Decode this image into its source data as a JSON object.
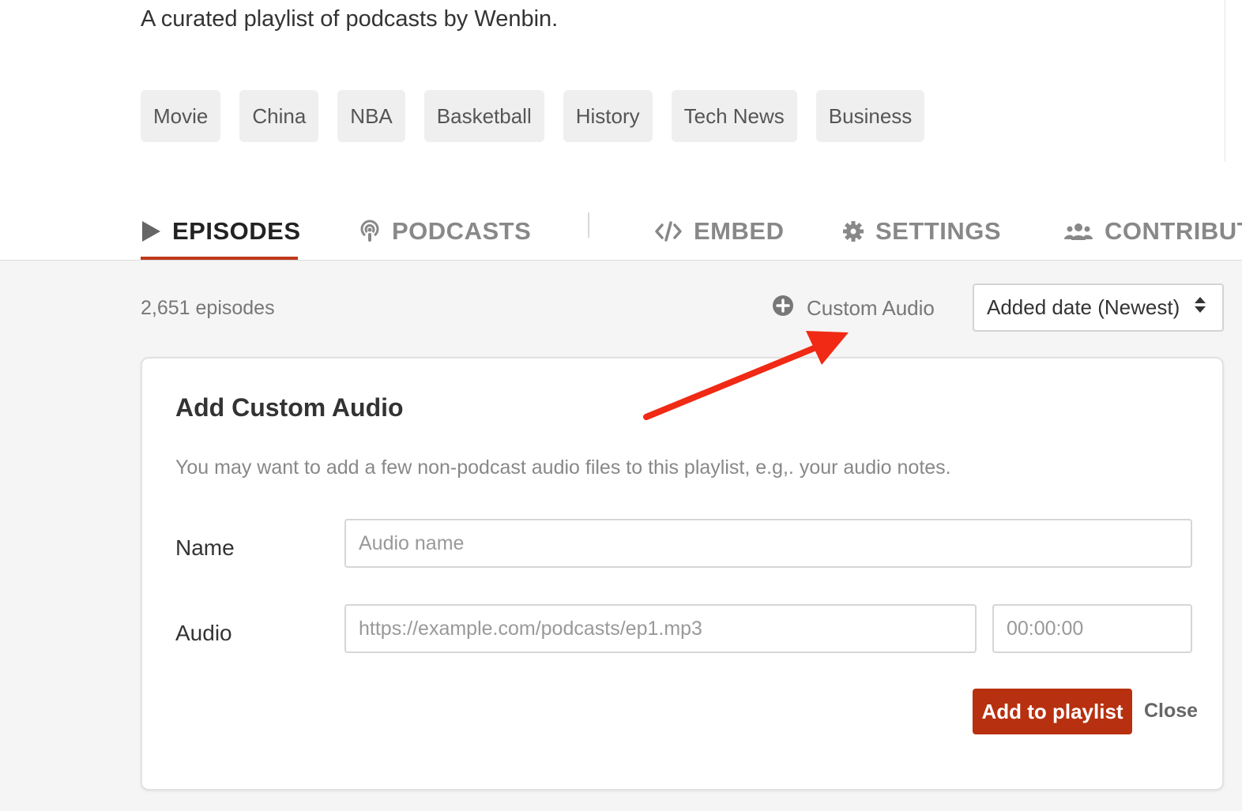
{
  "playlist": {
    "description": "A curated playlist of podcasts by Wenbin.",
    "tags": [
      "Movie",
      "China",
      "NBA",
      "Basketball",
      "History",
      "Tech News",
      "Business"
    ]
  },
  "tabs": {
    "episodes": "EPISODES",
    "podcasts": "PODCASTS",
    "embed": "EMBED",
    "settings": "SETTINGS",
    "contributors": "CONTRIBUT"
  },
  "toolbar": {
    "episode_count": "2,651 episodes",
    "custom_audio_label": "Custom Audio",
    "sort_value": "Added date (Newest)"
  },
  "custom_audio_form": {
    "title": "Add Custom Audio",
    "help": "You may want to add a few non-podcast audio files to this playlist, e.g,. your audio notes.",
    "name_label": "Name",
    "name_placeholder": "Audio name",
    "audio_label": "Audio",
    "audio_url_placeholder": "https://example.com/podcasts/ep1.mp3",
    "duration_placeholder": "00:00:00",
    "submit_label": "Add to playlist",
    "close_label": "Close"
  },
  "colors": {
    "accent": "#b7300f",
    "tab_underline": "#c0391b",
    "annotation_arrow": "#f02a14"
  }
}
